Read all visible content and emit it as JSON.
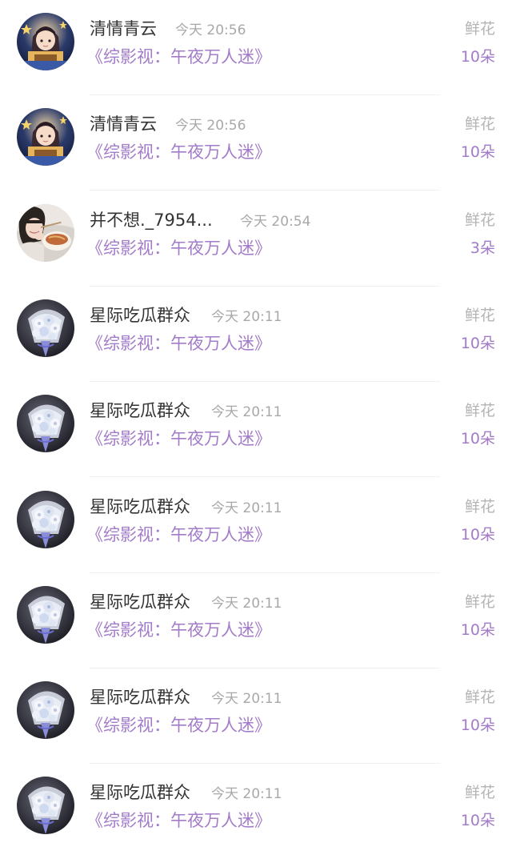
{
  "colors": {
    "name_text": "#333333",
    "time_text": "#a8a8a8",
    "accent_purple": "#a27bc9",
    "gift_type_text": "#b4b4b4",
    "divider": "#f0f0f0"
  },
  "entries": [
    {
      "avatar": "anime-girl-avatar",
      "name": "清情青云",
      "time": "今天 20:56",
      "book": "《综影视：午夜万人迷》",
      "gift_type": "鲜花",
      "gift_count": "10朵"
    },
    {
      "avatar": "anime-girl-avatar",
      "name": "清情青云",
      "time": "今天 20:56",
      "book": "《综影视：午夜万人迷》",
      "gift_type": "鲜花",
      "gift_count": "10朵"
    },
    {
      "avatar": "eating-girl-photo-avatar",
      "name": "并不想._7954...",
      "time": "今天 20:54",
      "book": "《综影视：午夜万人迷》",
      "gift_type": "鲜花",
      "gift_count": "3朵"
    },
    {
      "avatar": "flower-bouquet-avatar",
      "name": "星际吃瓜群众",
      "time": "今天 20:11",
      "book": "《综影视：午夜万人迷》",
      "gift_type": "鲜花",
      "gift_count": "10朵"
    },
    {
      "avatar": "flower-bouquet-avatar",
      "name": "星际吃瓜群众",
      "time": "今天 20:11",
      "book": "《综影视：午夜万人迷》",
      "gift_type": "鲜花",
      "gift_count": "10朵"
    },
    {
      "avatar": "flower-bouquet-avatar",
      "name": "星际吃瓜群众",
      "time": "今天 20:11",
      "book": "《综影视：午夜万人迷》",
      "gift_type": "鲜花",
      "gift_count": "10朵"
    },
    {
      "avatar": "flower-bouquet-avatar",
      "name": "星际吃瓜群众",
      "time": "今天 20:11",
      "book": "《综影视：午夜万人迷》",
      "gift_type": "鲜花",
      "gift_count": "10朵"
    },
    {
      "avatar": "flower-bouquet-avatar",
      "name": "星际吃瓜群众",
      "time": "今天 20:11",
      "book": "《综影视：午夜万人迷》",
      "gift_type": "鲜花",
      "gift_count": "10朵"
    },
    {
      "avatar": "flower-bouquet-avatar",
      "name": "星际吃瓜群众",
      "time": "今天 20:11",
      "book": "《综影视：午夜万人迷》",
      "gift_type": "鲜花",
      "gift_count": "10朵"
    }
  ]
}
